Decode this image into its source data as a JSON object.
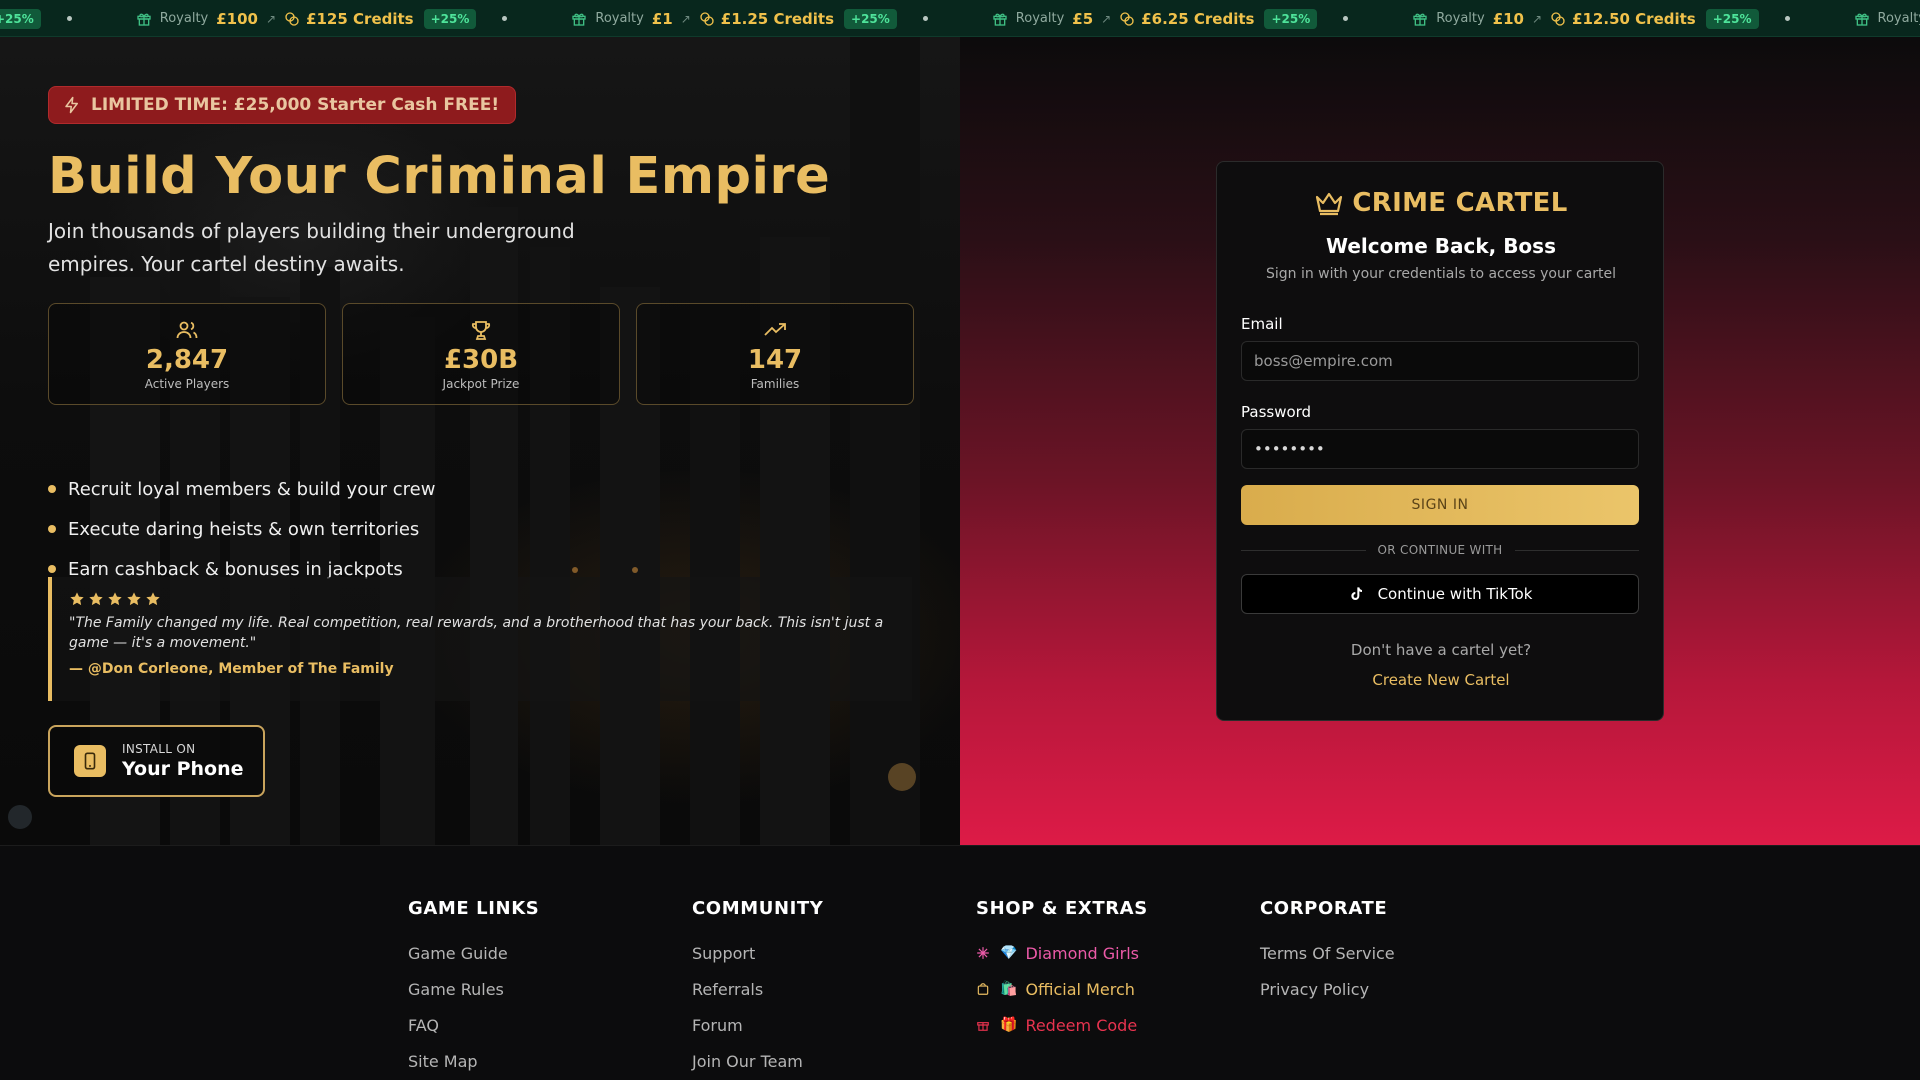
{
  "ticker": {
    "royalty_label": "Royalty",
    "bonus_badge": "+25%",
    "items": [
      {
        "amount": "£100",
        "credits": "£125 Credits"
      },
      {
        "amount": "£1",
        "credits": "£1.25 Credits"
      },
      {
        "amount": "£5",
        "credits": "£6.25 Credits"
      },
      {
        "amount": "£10",
        "credits": "£12.50 Credits"
      }
    ]
  },
  "hero": {
    "promo": "LIMITED TIME: £25,000 Starter Cash FREE!",
    "title": "Build Your Criminal Empire",
    "subtitle": "Join thousands of players building their underground empires. Your cartel destiny awaits.",
    "stats": [
      {
        "icon": "users-icon",
        "value": "2,847",
        "label": "Active Players"
      },
      {
        "icon": "trophy-icon",
        "value": "£30B",
        "label": "Jackpot Prize"
      },
      {
        "icon": "trending-up-icon",
        "value": "147",
        "label": "Families"
      }
    ],
    "features": [
      "Recruit loyal members & build your crew",
      "Execute daring heists & own territories",
      "Earn cashback & bonuses in jackpots"
    ],
    "testimonial": {
      "rating": 5,
      "quote": "\"The Family changed my life. Real competition, real rewards, and a brotherhood that has your back. This isn't just a game — it's a movement.\"",
      "author": "— @Don Corleone, Member of The Family"
    },
    "install": {
      "small": "INSTALL ON",
      "big": "Your Phone"
    }
  },
  "login": {
    "brand": "CRIME CARTEL",
    "welcome": "Welcome Back, Boss",
    "subtitle": "Sign in with your credentials to access your cartel",
    "email_label": "Email",
    "email_placeholder": "boss@empire.com",
    "password_label": "Password",
    "password_value": "••••••••",
    "signin_label": "SIGN IN",
    "divider": "OR CONTINUE WITH",
    "tiktok_label": "Continue with TikTok",
    "no_account": "Don't have a cartel yet?",
    "create_label": "Create New Cartel"
  },
  "footer": {
    "columns": [
      {
        "title": "GAME LINKS",
        "links": [
          "Game Guide",
          "Game Rules",
          "FAQ",
          "Site Map"
        ]
      },
      {
        "title": "COMMUNITY",
        "links": [
          "Support",
          "Referrals",
          "Forum",
          "Join Our Team"
        ]
      },
      {
        "title": "SHOP & EXTRAS",
        "links": [
          {
            "icon": "sparkles-icon",
            "emoji": "💎",
            "label": "Diamond Girls",
            "color": "#ec5aa8"
          },
          {
            "icon": "shopping-bag-icon",
            "emoji": "🛍️",
            "label": "Official Merch",
            "color": "#e9bd62"
          },
          {
            "icon": "gift-icon",
            "emoji": "🎁",
            "label": "Redeem Code",
            "color": "#e8334f"
          }
        ]
      },
      {
        "title": "CORPORATE",
        "links": [
          "Terms Of Service",
          "Privacy Policy"
        ]
      }
    ]
  },
  "colors": {
    "gold": "#e9bd62",
    "ticker_bg": "#08271d",
    "promo_red": "#8e1b1d",
    "accent_pink": "#dd1b47"
  }
}
